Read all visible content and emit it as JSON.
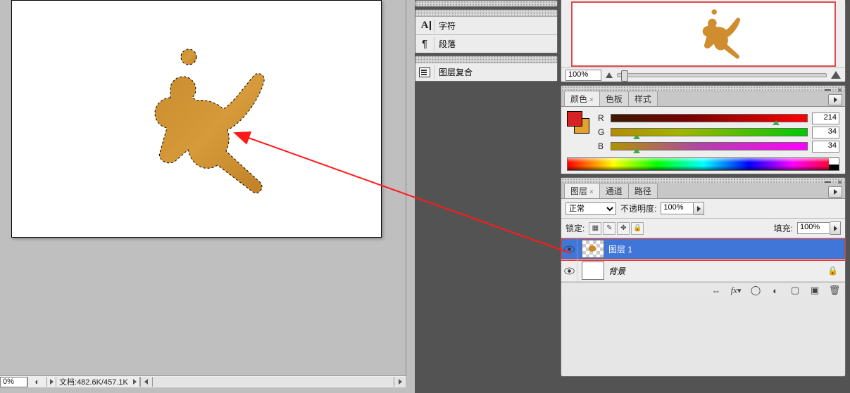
{
  "statusbar": {
    "zoom": "0%",
    "doc_label": "文档:",
    "doc_info": "482.6K/457.1K"
  },
  "tab_palettes": {
    "character": "字符",
    "paragraph": "段落",
    "layer_comps": "图层复合"
  },
  "navigator": {
    "zoom_value": "100%"
  },
  "color_panel": {
    "tab_color": "颜色",
    "tab_swatches": "色板",
    "tab_styles": "样式",
    "R_label": "R",
    "R_value": "214",
    "G_label": "G",
    "G_value": "34",
    "B_label": "B",
    "B_value": "34"
  },
  "layers_panel": {
    "tab_layers": "图层",
    "tab_channels": "通道",
    "tab_paths": "路径",
    "blend_mode": "正常",
    "opacity_label": "不透明度:",
    "opacity_value": "100%",
    "lock_label": "锁定:",
    "fill_label": "填充:",
    "fill_value": "100%",
    "layers": [
      {
        "name": "图层 1",
        "selected": true
      },
      {
        "name": "背景",
        "selected": false,
        "locked": true,
        "italic": true
      }
    ],
    "footer_fx": "fx"
  },
  "chart_data": null
}
